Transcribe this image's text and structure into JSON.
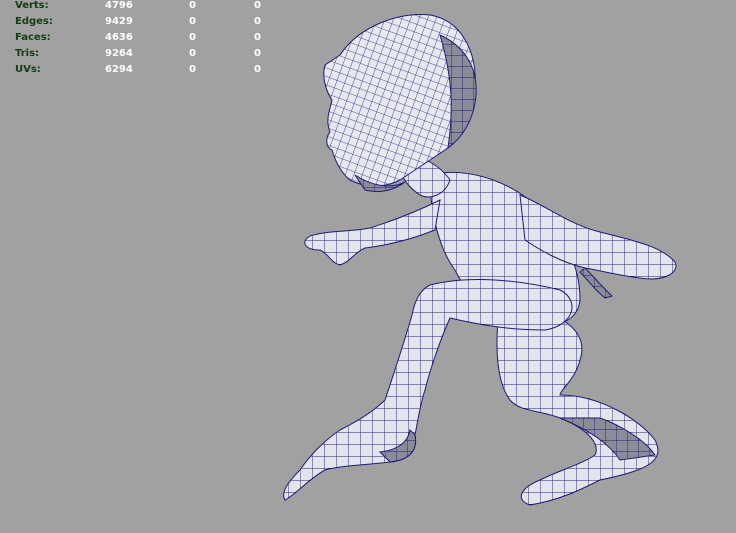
{
  "hud": {
    "rows": [
      {
        "label": "Verts:",
        "values": [
          "4796",
          "0",
          "0"
        ]
      },
      {
        "label": "Edges:",
        "values": [
          "9429",
          "0",
          "0"
        ]
      },
      {
        "label": "Faces:",
        "values": [
          "4636",
          "0",
          "0"
        ]
      },
      {
        "label": "Tris:",
        "values": [
          "9264",
          "0",
          "0"
        ]
      },
      {
        "label": "UVs:",
        "values": [
          "6294",
          "0",
          "0"
        ]
      }
    ]
  },
  "viewport": {
    "background": "#a1a1a1",
    "wireframe_color": "#1c1c78",
    "mesh_fill": "#e6e6ee",
    "shadow_fill": "#4a4a56"
  }
}
